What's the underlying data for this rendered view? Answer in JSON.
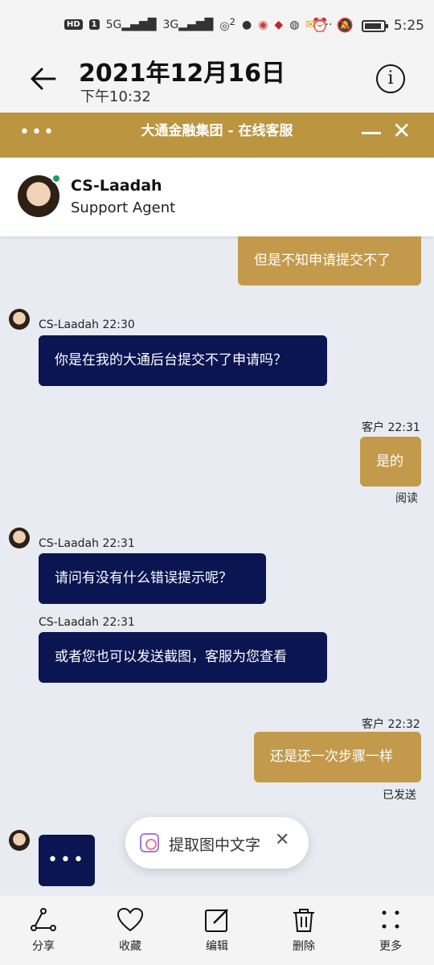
{
  "status_bar": {
    "left_icons": [
      "HD",
      "1",
      "5G",
      "3G",
      "2"
    ],
    "time": "5:25"
  },
  "viewer": {
    "date": "2021年12月16日",
    "time": "下午10:32"
  },
  "chat_window": {
    "title": "大通金融集团 - 在线客服",
    "menu_label": "•••"
  },
  "agent": {
    "name": "CS-Laadah",
    "role": "Support Agent",
    "status_color": "#1e9e5a"
  },
  "messages": [
    {
      "sender": "customer",
      "text": "但是不知申请提交不了"
    },
    {
      "sender": "agent",
      "meta": "CS-Laadah 22:30",
      "text": "你是在我的大通后台提交不了申请吗？"
    },
    {
      "sender": "customer",
      "meta": "客户 22:31",
      "text": "是的",
      "status": "阅读"
    },
    {
      "sender": "agent",
      "meta": "CS-Laadah 22:31",
      "text": "请问有没有什么错误提示呢？"
    },
    {
      "sender": "agent",
      "meta": "CS-Laadah 22:31",
      "text": "或者您也可以发送截图，客服为您查看"
    },
    {
      "sender": "customer",
      "meta": "客户 22:32",
      "text": "还是还一次步骤一样",
      "status": "已发送"
    },
    {
      "sender": "agent",
      "typing": "•••"
    }
  ],
  "ocr_popup": {
    "label": "提取图中文字",
    "close": "✕"
  },
  "actions": [
    {
      "label": "分享",
      "icon": "share-icon"
    },
    {
      "label": "收藏",
      "icon": "heart-icon"
    },
    {
      "label": "编辑",
      "icon": "edit-icon"
    },
    {
      "label": "删除",
      "icon": "trash-icon"
    },
    {
      "label": "更多",
      "icon": "more-icon"
    }
  ],
  "colors": {
    "gold": "#bb9540",
    "customer_bubble": "#c39a4b",
    "agent_bubble": "#0a1552",
    "chat_bg": "#e8ecf2"
  }
}
